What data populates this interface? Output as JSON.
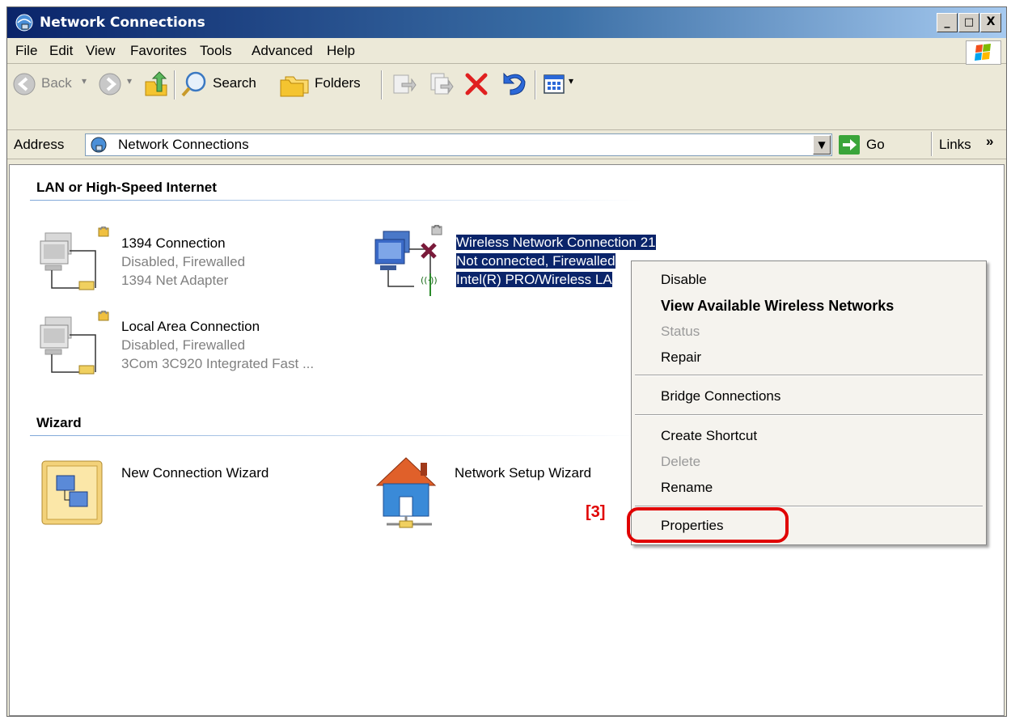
{
  "window": {
    "title": "Network Connections",
    "controls": [
      "_",
      "□",
      "X"
    ]
  },
  "menubar": {
    "items": [
      "File",
      "Edit",
      "View",
      "Favorites",
      "Tools",
      "Advanced",
      "Help"
    ]
  },
  "toolbar": {
    "back_label": "Back",
    "search_label": "Search",
    "folders_label": "Folders"
  },
  "address": {
    "label": "Address",
    "value": "Network Connections",
    "go_label": "Go",
    "links_label": "Links",
    "links_chevron": "»"
  },
  "groups": {
    "lan": {
      "title": "LAN or High-Speed Internet",
      "items": [
        {
          "name": "1394 Connection",
          "status": "Disabled, Firewalled",
          "device": "1394 Net Adapter"
        },
        {
          "name": "Wireless Network Connection 21",
          "status": "Not connected, Firewalled",
          "device": "Intel(R) PRO/Wireless LA"
        },
        {
          "name": "Local Area Connection",
          "status": "Disabled, Firewalled",
          "device": "3Com 3C920 Integrated Fast ..."
        }
      ]
    },
    "wizard": {
      "title": "Wizard",
      "items": [
        {
          "name": "New Connection Wizard"
        },
        {
          "name": "Network Setup Wizard"
        }
      ]
    }
  },
  "context_menu": {
    "items": [
      {
        "label": "Disable"
      },
      {
        "label": "View Available Wireless Networks"
      },
      {
        "label": "Status"
      },
      {
        "label": "Repair"
      },
      {
        "label": "Bridge Connections"
      },
      {
        "label": "Create Shortcut"
      },
      {
        "label": "Delete"
      },
      {
        "label": "Rename"
      },
      {
        "label": "Properties"
      }
    ]
  },
  "annotation": {
    "step_label": "[3]",
    "color": "#e00000"
  },
  "colors": {
    "selection": "#0A246A",
    "titlebar": "#0A246A",
    "chrome": "#ECE9D8"
  }
}
